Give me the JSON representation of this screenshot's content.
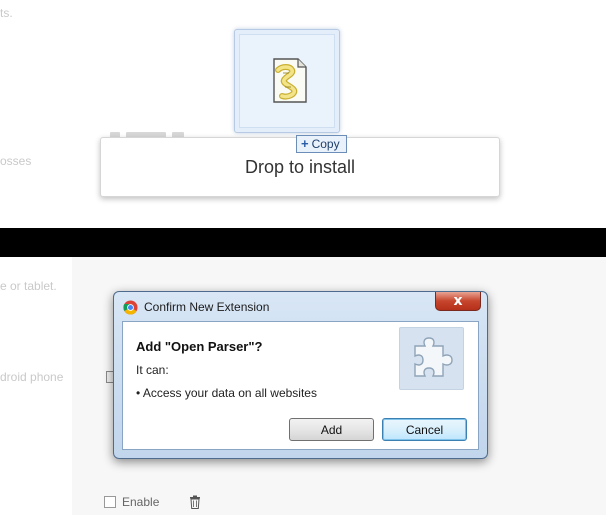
{
  "background": {
    "text_fragments": [
      "ts.",
      "osses",
      "e or tablet.",
      "droid phone"
    ],
    "enable_label": "Enable"
  },
  "drag": {
    "copy_label": "Copy",
    "drop_label": "Drop to install"
  },
  "dialog": {
    "title": "Confirm New Extension",
    "close_glyph": "x",
    "heading": "Add \"Open Parser\"?",
    "it_can": "It can:",
    "permissions": [
      "• Access your data on all websites"
    ],
    "buttons": {
      "add": "Add",
      "cancel": "Cancel"
    }
  },
  "colors": {
    "accent_blue": "#2b5ea8",
    "close_red": "#c7452c",
    "dialog_frame": "#c1d5ec"
  },
  "icons": [
    "script-file-icon",
    "chrome-icon",
    "puzzle-piece-icon",
    "trash-icon",
    "close-icon",
    "plus-icon"
  ]
}
